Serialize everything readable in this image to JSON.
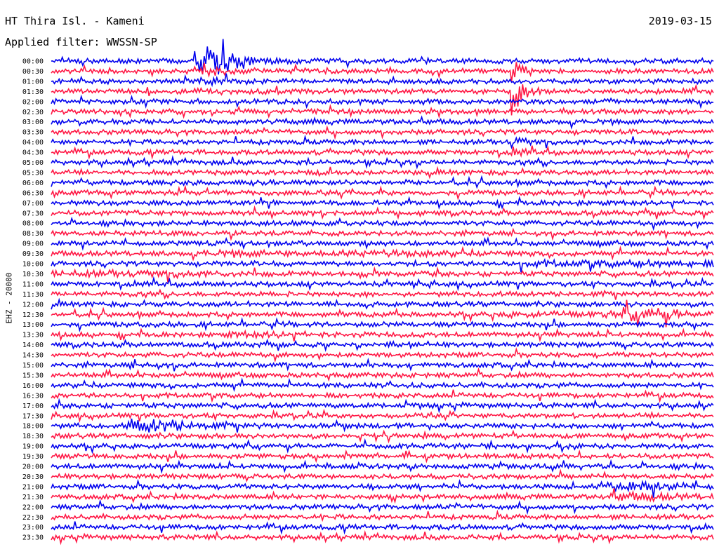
{
  "header": {
    "station": "HT Thira Isl. - Kameni",
    "date": "2019-03-15",
    "filter": "Applied filter: WWSSN-SP"
  },
  "chart_data": {
    "type": "line",
    "title": "HT Thira Isl. - Kameni",
    "subtitle": "Applied filter: WWSSN-SP",
    "ylabel": "EHZ - 20000",
    "xlabel": "",
    "colors": [
      "#0000ee",
      "#ff1744"
    ],
    "ticks": [
      "00:00",
      "00:30",
      "01:00",
      "01:30",
      "02:00",
      "02:30",
      "03:00",
      "03:30",
      "04:00",
      "04:30",
      "05:00",
      "05:30",
      "06:00",
      "06:30",
      "07:00",
      "07:30",
      "08:00",
      "08:30",
      "09:00",
      "09:30",
      "10:00",
      "10:30",
      "11:00",
      "11:30",
      "12:00",
      "12:30",
      "13:00",
      "13:30",
      "14:00",
      "14:30",
      "15:00",
      "15:30",
      "16:00",
      "16:30",
      "17:00",
      "17:30",
      "18:00",
      "18:30",
      "19:00",
      "19:30",
      "20:00",
      "20:30",
      "21:00",
      "21:30",
      "22:00",
      "22:30",
      "23:00",
      "23:30"
    ],
    "trace_minutes": 15,
    "xlim": [
      0,
      15
    ],
    "events": [
      {
        "row": 0,
        "start": 3.3,
        "end": 3.9,
        "peak": 6.0,
        "decay": 0.45,
        "color": "#0000ee"
      },
      {
        "row": 1,
        "start": 3.3,
        "end": 3.8,
        "peak": 1.8,
        "decay": 0.5,
        "color": "#ff1744"
      },
      {
        "row": 2,
        "start": 3.3,
        "end": 3.8,
        "peak": 1.6,
        "decay": 0.5,
        "color": "#0000ee"
      },
      {
        "row": 3,
        "start": 3.3,
        "end": 3.8,
        "peak": 1.4,
        "decay": 0.5,
        "color": "#ff1744"
      },
      {
        "row": 1,
        "start": 10.45,
        "end": 10.55,
        "peak": 4.0,
        "decay": 0.2,
        "color": "#ff1744"
      },
      {
        "row": 3,
        "start": 10.45,
        "end": 10.55,
        "peak": 6.5,
        "decay": 0.2,
        "color": "#ff1744"
      },
      {
        "row": 8,
        "start": 10.45,
        "end": 10.55,
        "peak": 2.5,
        "decay": 0.2,
        "color": "#0000ee"
      },
      {
        "row": 9,
        "start": 10.45,
        "end": 10.55,
        "peak": 1.8,
        "decay": 0.2,
        "color": "#ff1744"
      },
      {
        "row": 19,
        "start": 3.5,
        "end": 9.0,
        "peak": 1.4,
        "decay": 1.0,
        "color": "#ff1744"
      },
      {
        "row": 20,
        "start": 10.5,
        "end": 15.0,
        "peak": 1.5,
        "decay": 1.0,
        "color": "#0000ee"
      },
      {
        "row": 21,
        "start": 0.0,
        "end": 3.0,
        "peak": 1.5,
        "decay": 1.0,
        "color": "#ff1744"
      },
      {
        "row": 25,
        "start": 10.0,
        "end": 15.0,
        "peak": 1.3,
        "decay": 1.0,
        "color": "#ff1744"
      },
      {
        "row": 25,
        "start": 13.0,
        "end": 13.8,
        "peak": 2.8,
        "decay": 0.6,
        "color": "#ff1744"
      },
      {
        "row": 27,
        "start": 4.0,
        "end": 5.5,
        "peak": 1.4,
        "decay": 0.8,
        "color": "#ff1744"
      },
      {
        "row": 30,
        "start": 1.8,
        "end": 2.2,
        "peak": 1.5,
        "decay": 0.4,
        "color": "#0000ee"
      },
      {
        "row": 36,
        "start": 1.7,
        "end": 2.6,
        "peak": 2.8,
        "decay": 0.7,
        "color": "#0000ee"
      },
      {
        "row": 42,
        "start": 12.5,
        "end": 13.6,
        "peak": 2.2,
        "decay": 0.8,
        "color": "#ff1744"
      },
      {
        "row": 43,
        "start": 12.6,
        "end": 13.6,
        "peak": 1.8,
        "decay": 0.8,
        "color": "#ff1744"
      }
    ]
  }
}
